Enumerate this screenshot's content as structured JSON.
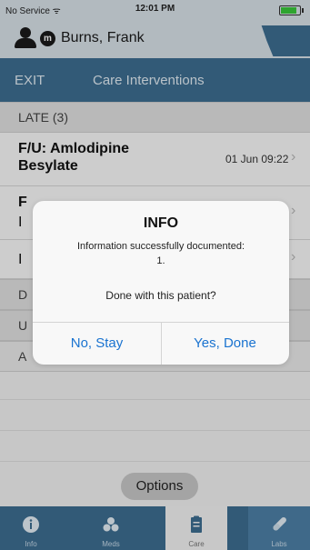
{
  "status_bar": {
    "carrier": "No Service ᯤ",
    "time": "12:01 PM"
  },
  "patient": {
    "badge": "m",
    "name": "Burns, Frank"
  },
  "nav": {
    "exit_label": "EXIT",
    "title": "Care Interventions"
  },
  "list": {
    "section_late": "LATE (3)",
    "row1_name_line1": "F/U: Amlodipine",
    "row1_name_line2": "Besylate",
    "row1_date": "01 Jun 09:22",
    "row2_name": "F",
    "row2_sub": "I",
    "row3_name": "I",
    "section_d": "D",
    "section_u": "U",
    "section_a": "A"
  },
  "alert": {
    "title": "INFO",
    "message_line1": "Information successfully documented:",
    "message_line2": "1.",
    "question": "Done with this patient?",
    "stay_label": "No, Stay",
    "done_label": "Yes, Done"
  },
  "options_label": "Options",
  "tabs": [
    {
      "label": "Info",
      "icon": "info-icon"
    },
    {
      "label": "Meds",
      "icon": "meds-icon"
    },
    {
      "label": "Care",
      "icon": "clipboard-icon"
    },
    {
      "label": "Labs",
      "icon": "test-tube-icon"
    }
  ],
  "colors": {
    "nav_blue": "#3d6e92",
    "accent_blue": "#1a73d0",
    "battery_green": "#39c83a"
  }
}
